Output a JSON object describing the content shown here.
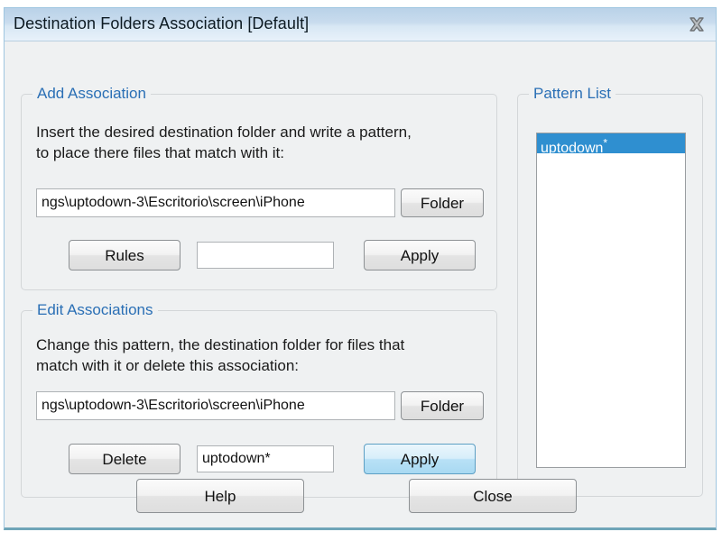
{
  "window": {
    "title": "Destination Folders Association [Default]",
    "close_icon": "close-x-icon"
  },
  "add_association": {
    "legend": "Add Association",
    "instruction": "Insert the desired destination folder and write a pattern,\nto place there files that match with it:",
    "folder_path_value": "ngs\\uptodown-3\\Escritorio\\screen\\iPhone",
    "folder_button_label": "Folder",
    "rules_button_label": "Rules",
    "pattern_value": "",
    "pattern_placeholder": "",
    "apply_button_label": "Apply"
  },
  "edit_associations": {
    "legend": "Edit Associations",
    "instruction": "Change this pattern, the destination folder for files that\nmatch with it or delete this association:",
    "folder_path_value": "ngs\\uptodown-3\\Escritorio\\screen\\iPhone",
    "folder_button_label": "Folder",
    "delete_button_label": "Delete",
    "pattern_value": "uptodown*",
    "apply_button_label": "Apply"
  },
  "pattern_list": {
    "legend": "Pattern List",
    "items": [
      {
        "label": "uptodown*",
        "selected": true
      }
    ]
  },
  "footer": {
    "help_button_label": "Help",
    "close_button_label": "Close"
  },
  "colors": {
    "legend_blue": "#2a6fb5",
    "selection_blue": "#2f8fd0",
    "hover_blue": "#a8d9f2",
    "titlebar_blue": "#c9dcee",
    "window_border": "#9fc6e0",
    "bottom_border": "#6fa5b8"
  }
}
